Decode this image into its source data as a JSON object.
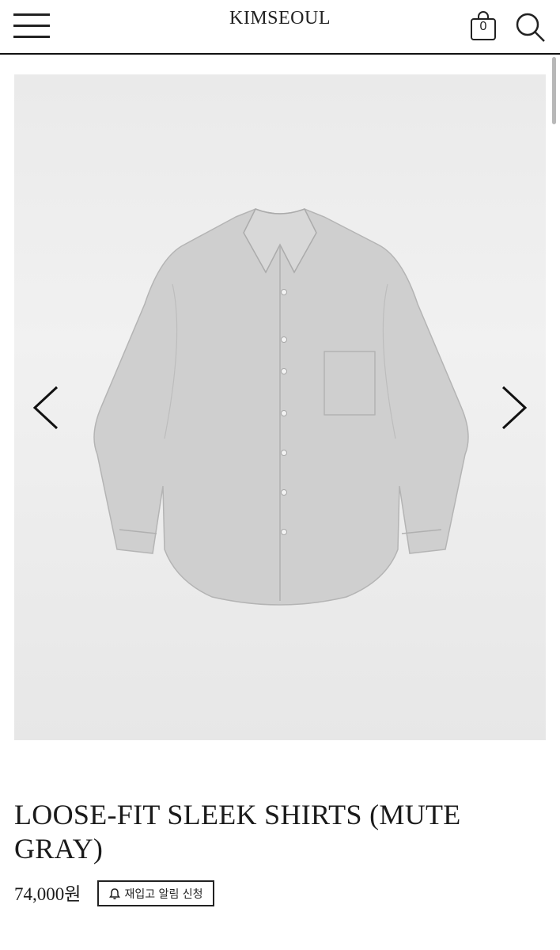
{
  "header": {
    "brand": "KIMSEOUL",
    "cart_count": "0",
    "menu_icon": "hamburger-menu-icon",
    "cart_icon": "shopping-bag-icon",
    "search_icon": "search-icon"
  },
  "gallery": {
    "prev_icon": "chevron-left-icon",
    "next_icon": "chevron-right-icon",
    "image_subject": "gray long-sleeve shirt"
  },
  "product": {
    "title": "LOOSE-FIT SLEEK SHIRTS (MUTE GRAY)",
    "price": "74,000원",
    "restock_label": "재입고 알림 신청",
    "restock_icon": "bell-icon"
  },
  "colors": {
    "text": "#111111",
    "gallery_bg": "#ececec",
    "shirt": "#c9c9c9"
  }
}
